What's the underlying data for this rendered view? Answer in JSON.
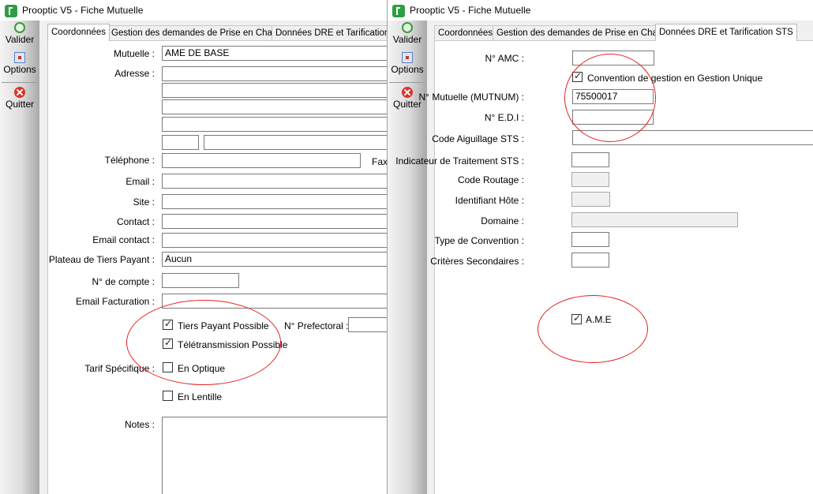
{
  "window1": {
    "title": "Prooptic V5 - Fiche Mutuelle",
    "sidebar": {
      "valider": "Valider",
      "options": "Options",
      "quitter": "Quitter"
    },
    "tabs": [
      "Coordonnées",
      "Gestion des demandes de Prise en Charge",
      "Données DRE et Tarification STS"
    ],
    "form": {
      "mutuelle_label": "Mutuelle :",
      "mutuelle_value": "AME DE BASE",
      "adresse_label": "Adresse :",
      "telephone_label": "Téléphone :",
      "fax_label": "Fax",
      "email_label": "Email :",
      "site_label": "Site :",
      "contact_label": "Contact :",
      "email_contact_label": "Email contact :",
      "plateau_label": "Plateau de Tiers Payant :",
      "plateau_value": "Aucun",
      "compte_label": "N° de compte :",
      "email_facturation_label": "Email Facturation :",
      "tiers_payant_label": "Tiers Payant Possible",
      "teletransmission_label": "Télétransmission Possible",
      "prefectoral_label": "N° Prefectoral :",
      "tarif_label": "Tarif Spécifique :",
      "en_optique_label": "En Optique",
      "en_lentille_label": "En Lentille",
      "notes_label": "Notes :"
    }
  },
  "window2": {
    "title": "Prooptic V5 - Fiche Mutuelle",
    "sidebar": {
      "valider": "Valider",
      "options": "Options",
      "quitter": "Quitter"
    },
    "tabs": [
      "Coordonnées",
      "Gestion des demandes de Prise en Charge",
      "Données DRE et Tarification STS"
    ],
    "form": {
      "amc_label": "N° AMC :",
      "convention_label": "Convention de gestion en Gestion Unique",
      "mutnum_label": "N° Mutuelle (MUTNUM) :",
      "mutnum_value": "75500017",
      "edi_label": "N° E.D.I :",
      "aiguillage_label": "Code Aiguillage STS :",
      "indicateur_label": "Indicateur de Traitement STS :",
      "routage_label": "Code Routage :",
      "hote_label": "Identifiant Hôte :",
      "domaine_label": "Domaine :",
      "type_convention_label": "Type de Convention :",
      "criteres_label": "Critères Secondaires :",
      "ame_label": "A.M.E"
    }
  }
}
